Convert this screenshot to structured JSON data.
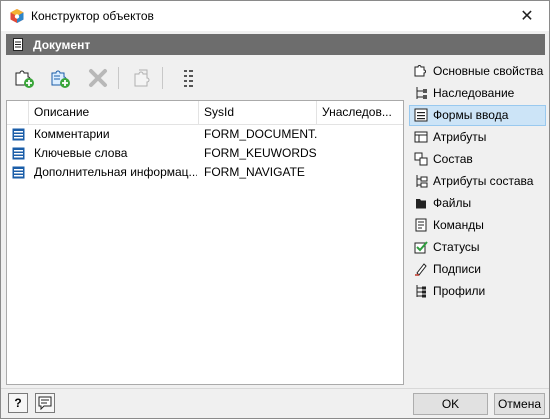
{
  "window": {
    "title": "Конструктор объектов"
  },
  "section": {
    "title": "Документ"
  },
  "toolbar": {
    "buttons": [
      {
        "name": "add-icon"
      },
      {
        "name": "add-linked-icon"
      },
      {
        "name": "delete-icon"
      },
      {
        "name": "copy-icon"
      },
      {
        "name": "order-icon"
      }
    ]
  },
  "table": {
    "columns": [
      "Описание",
      "SysId",
      "Унаследов..."
    ],
    "rows": [
      {
        "description": "Комментарии",
        "sysid": "FORM_DOCUMENT..."
      },
      {
        "description": "Ключевые слова",
        "sysid": "FORM_KEUWORDS"
      },
      {
        "description": "Дополнительная информац...",
        "sysid": "FORM_NAVIGATE"
      }
    ]
  },
  "nav": {
    "items": [
      {
        "label": "Основные свойства",
        "icon": "properties-icon"
      },
      {
        "label": "Наследование",
        "icon": "inheritance-icon"
      },
      {
        "label": "Формы ввода",
        "icon": "input-forms-icon",
        "active": true
      },
      {
        "label": "Атрибуты",
        "icon": "attributes-icon"
      },
      {
        "label": "Состав",
        "icon": "composition-icon"
      },
      {
        "label": "Атрибуты состава",
        "icon": "composition-attributes-icon"
      },
      {
        "label": "Файлы",
        "icon": "files-icon"
      },
      {
        "label": "Команды",
        "icon": "commands-icon"
      },
      {
        "label": "Статусы",
        "icon": "statuses-icon"
      },
      {
        "label": "Подписи",
        "icon": "signatures-icon"
      },
      {
        "label": "Профили",
        "icon": "profiles-icon"
      }
    ]
  },
  "footer": {
    "help_label": "?",
    "ok_label": "OK",
    "cancel_label": "Отмена"
  }
}
